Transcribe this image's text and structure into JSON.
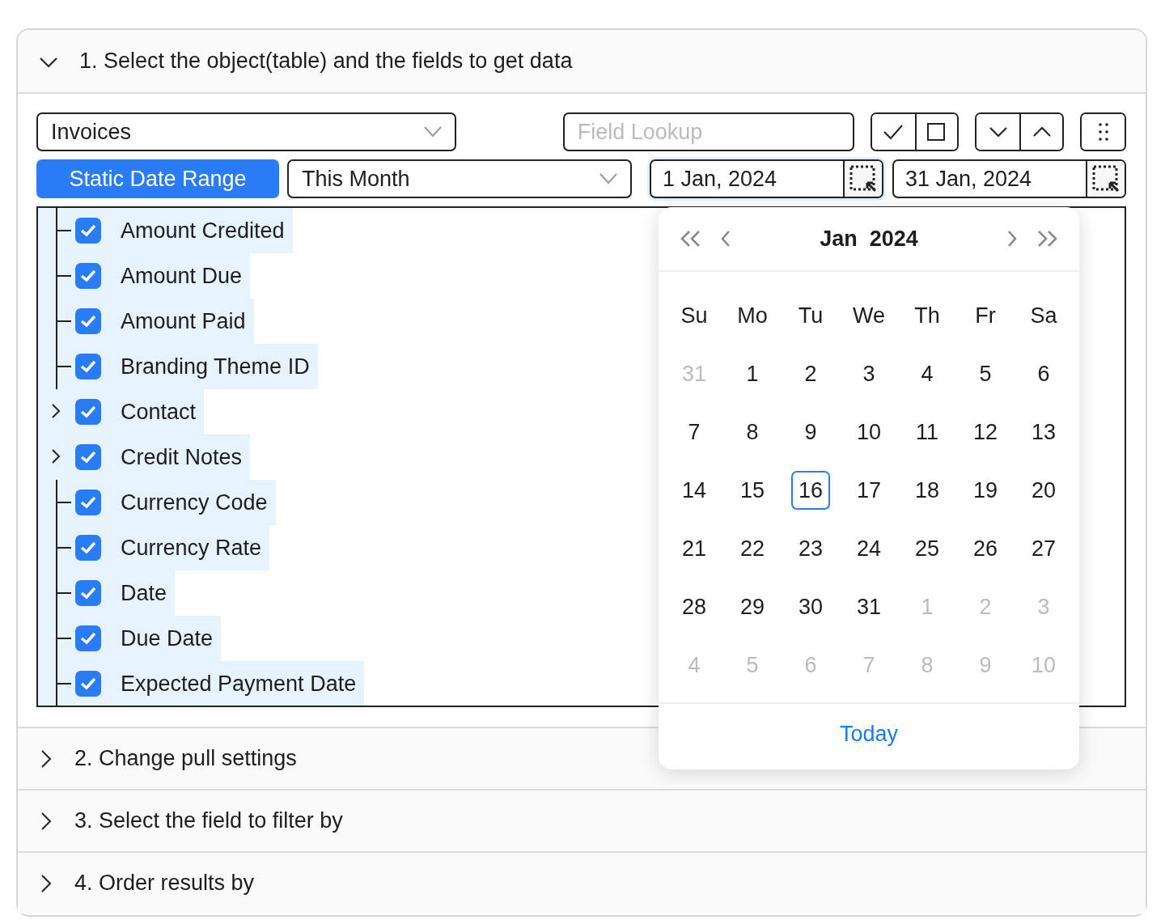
{
  "sections": [
    {
      "title": "1. Select the object(table) and the fields to get data",
      "expanded": true
    },
    {
      "title": "2. Change pull settings",
      "expanded": false
    },
    {
      "title": "3. Select the field to filter by",
      "expanded": false
    },
    {
      "title": "4. Order results by",
      "expanded": false
    }
  ],
  "object_select": {
    "value": "Invoices"
  },
  "field_lookup": {
    "placeholder": "Field Lookup"
  },
  "date_mode_button": {
    "label": "Static Date Range"
  },
  "range_select": {
    "value": "This Month"
  },
  "date_fields": [
    {
      "value": "1 Jan, 2024",
      "focused": true
    },
    {
      "value": "31 Jan, 2024",
      "focused": false
    }
  ],
  "fields": [
    {
      "label": "Amount Credited",
      "kind": "field",
      "checked": true,
      "selected": true
    },
    {
      "label": "Amount Due",
      "kind": "field",
      "checked": true,
      "selected": true
    },
    {
      "label": "Amount Paid",
      "kind": "field",
      "checked": true,
      "selected": true
    },
    {
      "label": "Branding Theme ID",
      "kind": "field",
      "checked": true,
      "selected": true
    },
    {
      "label": "Contact",
      "kind": "group",
      "expanded": false,
      "checked": true,
      "selected": true
    },
    {
      "label": "Credit Notes",
      "kind": "group",
      "expanded": false,
      "checked": true,
      "selected": true
    },
    {
      "label": "Currency Code",
      "kind": "field",
      "checked": true,
      "selected": true
    },
    {
      "label": "Currency Rate",
      "kind": "field",
      "checked": true,
      "selected": true
    },
    {
      "label": "Date",
      "kind": "field",
      "checked": true,
      "selected": true
    },
    {
      "label": "Due Date",
      "kind": "field",
      "checked": true,
      "selected": true
    },
    {
      "label": "Expected Payment Date",
      "kind": "field",
      "checked": true,
      "selected": true
    }
  ],
  "calendar": {
    "month": "Jan",
    "year": "2024",
    "weekdays": [
      "Su",
      "Mo",
      "Tu",
      "We",
      "Th",
      "Fr",
      "Sa"
    ],
    "days": [
      {
        "label": "31",
        "outside": true,
        "selected": false
      },
      {
        "label": "1",
        "outside": false,
        "selected": false
      },
      {
        "label": "2",
        "outside": false,
        "selected": false
      },
      {
        "label": "3",
        "outside": false,
        "selected": false
      },
      {
        "label": "4",
        "outside": false,
        "selected": false
      },
      {
        "label": "5",
        "outside": false,
        "selected": false
      },
      {
        "label": "6",
        "outside": false,
        "selected": false
      },
      {
        "label": "7",
        "outside": false,
        "selected": false
      },
      {
        "label": "8",
        "outside": false,
        "selected": false
      },
      {
        "label": "9",
        "outside": false,
        "selected": false
      },
      {
        "label": "10",
        "outside": false,
        "selected": false
      },
      {
        "label": "11",
        "outside": false,
        "selected": false
      },
      {
        "label": "12",
        "outside": false,
        "selected": false
      },
      {
        "label": "13",
        "outside": false,
        "selected": false
      },
      {
        "label": "14",
        "outside": false,
        "selected": false
      },
      {
        "label": "15",
        "outside": false,
        "selected": false
      },
      {
        "label": "16",
        "outside": false,
        "selected": true
      },
      {
        "label": "17",
        "outside": false,
        "selected": false
      },
      {
        "label": "18",
        "outside": false,
        "selected": false
      },
      {
        "label": "19",
        "outside": false,
        "selected": false
      },
      {
        "label": "20",
        "outside": false,
        "selected": false
      },
      {
        "label": "21",
        "outside": false,
        "selected": false
      },
      {
        "label": "22",
        "outside": false,
        "selected": false
      },
      {
        "label": "23",
        "outside": false,
        "selected": false
      },
      {
        "label": "24",
        "outside": false,
        "selected": false
      },
      {
        "label": "25",
        "outside": false,
        "selected": false
      },
      {
        "label": "26",
        "outside": false,
        "selected": false
      },
      {
        "label": "27",
        "outside": false,
        "selected": false
      },
      {
        "label": "28",
        "outside": false,
        "selected": false
      },
      {
        "label": "29",
        "outside": false,
        "selected": false
      },
      {
        "label": "30",
        "outside": false,
        "selected": false
      },
      {
        "label": "31",
        "outside": false,
        "selected": false
      },
      {
        "label": "1",
        "outside": true,
        "selected": false
      },
      {
        "label": "2",
        "outside": true,
        "selected": false
      },
      {
        "label": "3",
        "outside": true,
        "selected": false
      },
      {
        "label": "4",
        "outside": true,
        "selected": false
      },
      {
        "label": "5",
        "outside": true,
        "selected": false
      },
      {
        "label": "6",
        "outside": true,
        "selected": false
      },
      {
        "label": "7",
        "outside": true,
        "selected": false
      },
      {
        "label": "8",
        "outside": true,
        "selected": false
      },
      {
        "label": "9",
        "outside": true,
        "selected": false
      },
      {
        "label": "10",
        "outside": true,
        "selected": false
      }
    ],
    "today_link": "Today"
  }
}
